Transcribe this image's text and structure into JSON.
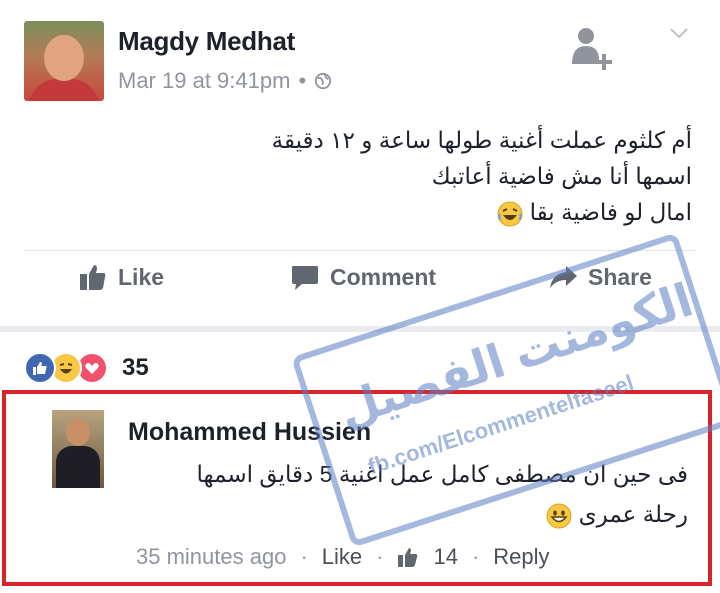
{
  "post": {
    "author": "Magdy Medhat",
    "timestamp": "Mar 19 at 9:41pm",
    "meta_separator": "•",
    "text_lines": [
      "أم كلثوم عملت أغنية طولها ساعة و ١٢ دقيقة",
      "اسمها أنا مش فاضية أعاتبك",
      "امال  لو فاضية بقا"
    ]
  },
  "actions": {
    "like": "Like",
    "comment": "Comment",
    "share": "Share"
  },
  "reactions": {
    "count": "35",
    "types": [
      "like",
      "haha",
      "love"
    ]
  },
  "comment": {
    "author": "Mohammed Hussien",
    "text_lines": [
      "فى حين ان مصطفى كامل عمل اغنية 5 دقايق اسمها",
      "رحلة عمرى"
    ],
    "time": "35 minutes ago",
    "like": "Like",
    "likes_count": "14",
    "reply": "Reply"
  },
  "watermark": {
    "title": "الكومنت الفصيل",
    "url": "fb.com/Elcommentelfaseel"
  },
  "colors": {
    "fb_blue": "#4267b2",
    "text": "#1d2129",
    "muted": "#90949c",
    "highlight_border": "#d6242b"
  }
}
